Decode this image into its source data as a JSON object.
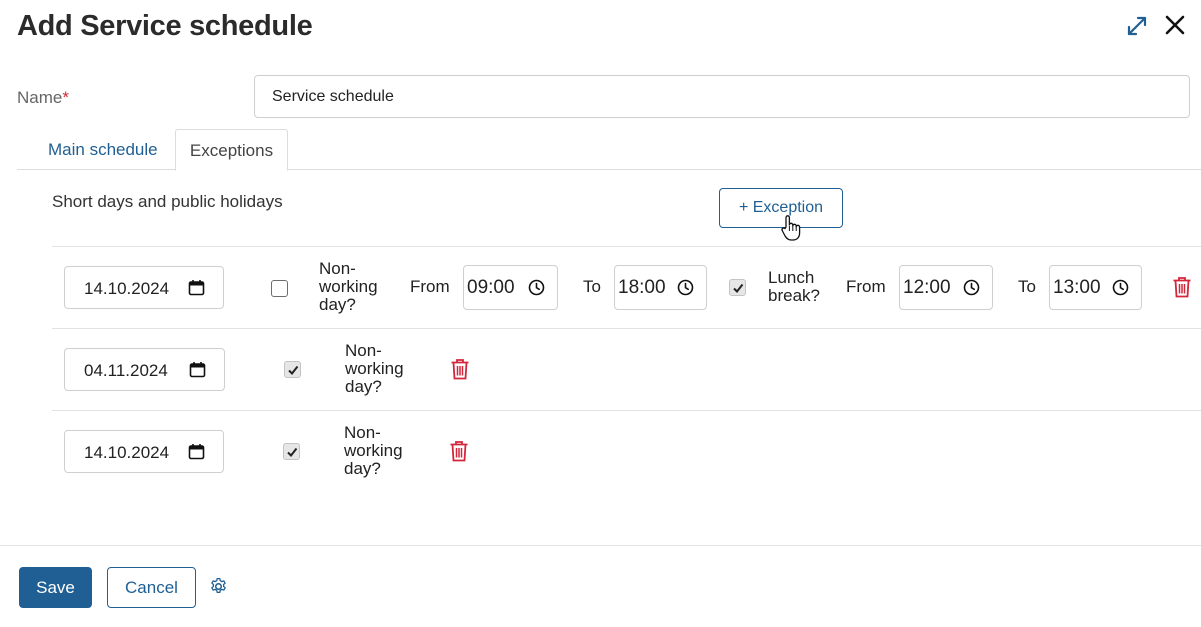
{
  "header": {
    "title": "Add Service schedule"
  },
  "form": {
    "name_label": "Name",
    "required_mark": "*",
    "name_value": "Service schedule"
  },
  "tabs": [
    {
      "label": "Main schedule",
      "active": false
    },
    {
      "label": "Exceptions",
      "active": true
    }
  ],
  "exceptions": {
    "section_title": "Short days and public holidays",
    "add_button_label": "+ Exception",
    "rows": [
      {
        "date": "14.10.2024",
        "non_working_checked": false,
        "non_working_label": "Non-working day?",
        "from_label": "From",
        "from_time": "09:00",
        "to_label": "To",
        "to_time": "18:00",
        "lunch_checked": true,
        "lunch_label": "Lunch break?",
        "lunch_from_label": "From",
        "lunch_from_time": "12:00",
        "lunch_to_label": "To",
        "lunch_to_time": "13:00"
      },
      {
        "date": "04.11.2024",
        "non_working_checked": true,
        "non_working_label": "Non-working day?"
      },
      {
        "date": "14.10.2024",
        "non_working_checked": true,
        "non_working_label": "Non-working day?"
      }
    ]
  },
  "footer": {
    "save_label": "Save",
    "cancel_label": "Cancel"
  },
  "colors": {
    "primary": "#1f5f93",
    "danger": "#d3263b",
    "required": "#d3263b"
  },
  "icons": [
    "expand-icon",
    "close-icon",
    "calendar-icon",
    "clock-icon",
    "trash-icon",
    "gear-icon",
    "hand-cursor-icon"
  ]
}
